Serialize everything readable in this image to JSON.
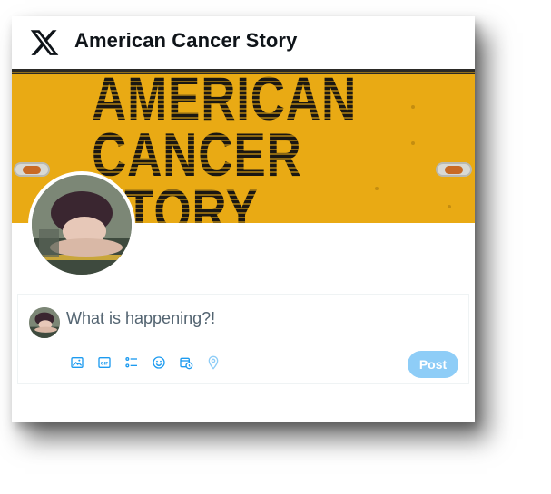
{
  "header": {
    "logo_icon": "x-logo-icon",
    "title": "American Cancer Story"
  },
  "banner": {
    "text": "AMERICAN\nCANCER\nSTORY",
    "background_color": "#e9aa14"
  },
  "compose": {
    "placeholder": "What is happening?!",
    "tools": [
      "image-icon",
      "gif-icon",
      "poll-icon",
      "emoji-icon",
      "schedule-icon",
      "location-icon"
    ],
    "post_label": "Post",
    "accent_color": "#1d9bf0"
  }
}
